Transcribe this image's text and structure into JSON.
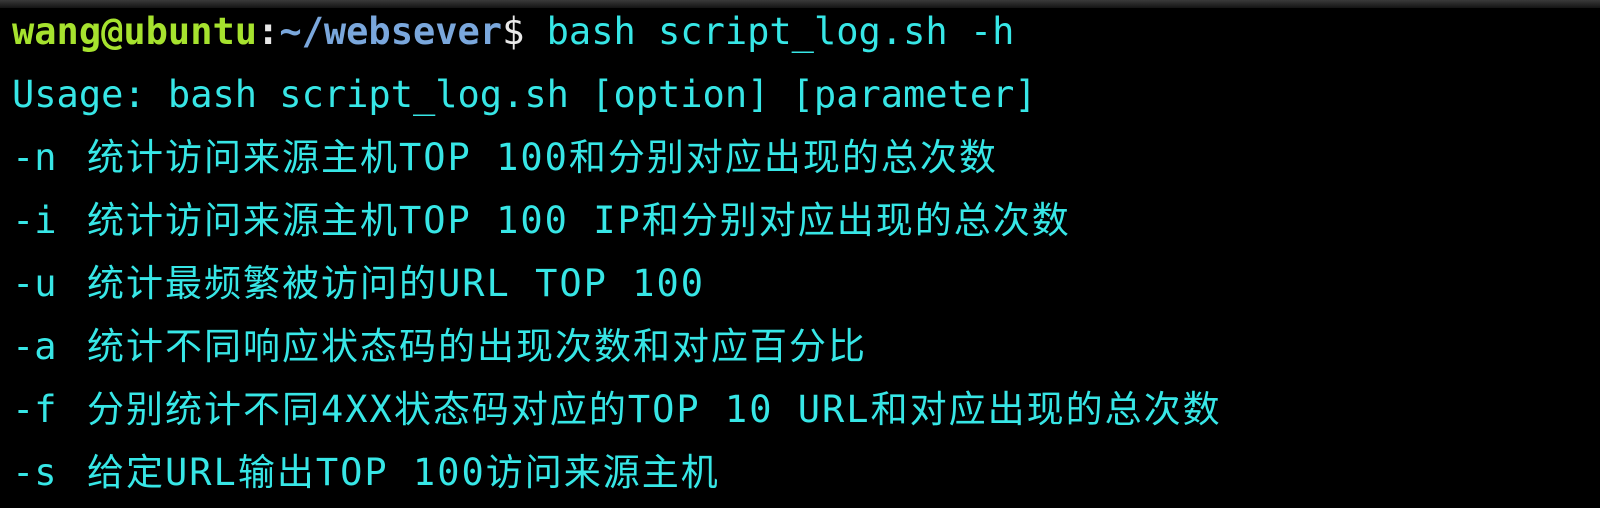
{
  "prompt": {
    "user_host": "wang@ubuntu",
    "colon": ":",
    "path": "~/websever",
    "symbol": "$",
    "command": " bash script_log.sh -h"
  },
  "output": {
    "usage": "Usage: bash script_log.sh [option] [parameter]",
    "options": [
      {
        "flag": "-n",
        "desc": "统计访问来源主机TOP 100和分别对应出现的总次数"
      },
      {
        "flag": "-i",
        "desc": "统计访问来源主机TOP 100 IP和分别对应出现的总次数"
      },
      {
        "flag": "-u",
        "desc": "统计最频繁被访问的URL TOP 100"
      },
      {
        "flag": "-a",
        "desc": "统计不同响应状态码的出现次数和对应百分比"
      },
      {
        "flag": "-f",
        "desc": "分别统计不同4XX状态码对应的TOP 10 URL和对应出现的总次数"
      },
      {
        "flag": "-s",
        "desc": "给定URL输出TOP 100访问来源主机"
      }
    ]
  },
  "colors": {
    "background": "#000000",
    "prompt_user": "#a6e22e",
    "prompt_path": "#7aa7dc",
    "output_text": "#37e6e6"
  }
}
